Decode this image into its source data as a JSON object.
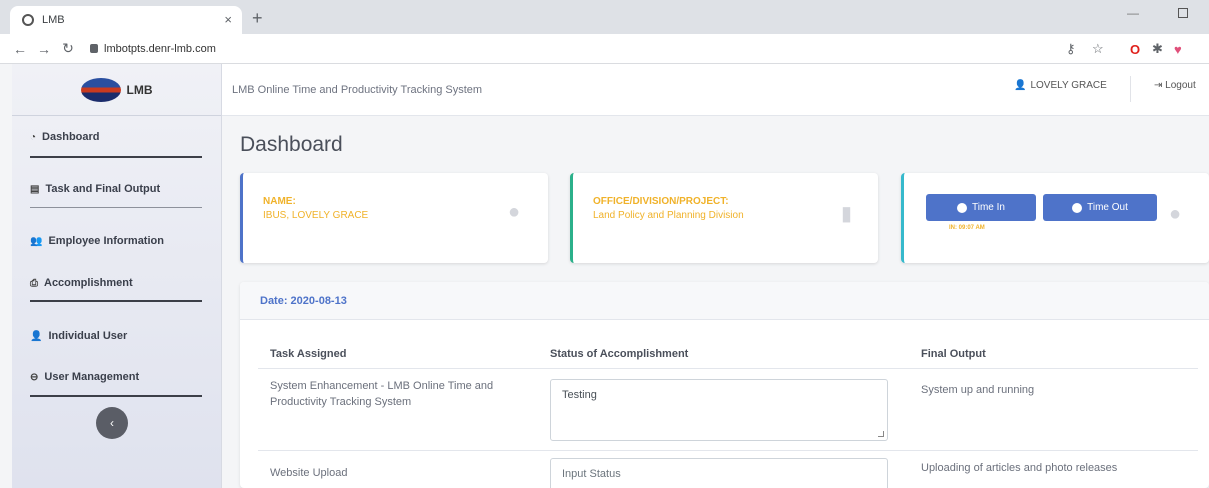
{
  "browser": {
    "tab_title": "LMB",
    "tab_close": "×",
    "new_tab": "+",
    "url": "lmbotpts.denr-lmb.com",
    "minimize": "—"
  },
  "sidebar": {
    "brand": "LMB",
    "collapse": "‹",
    "items": [
      {
        "label": "Dashboard",
        "icon": "dashboard-icon"
      },
      {
        "label": "Task and Final Output",
        "icon": "list-icon"
      },
      {
        "label": "Employee Information",
        "icon": "users-icon"
      },
      {
        "label": "Accomplishment",
        "icon": "printer-icon"
      },
      {
        "label": "Individual User",
        "icon": "user-icon"
      },
      {
        "label": "User Management",
        "icon": "user-circle-icon"
      }
    ]
  },
  "header": {
    "app_title": "LMB Online Time and Productivity Tracking System",
    "user_name": "LOVELY GRACE",
    "logout": "Logout"
  },
  "page": {
    "title": "Dashboard"
  },
  "cards": {
    "name_label": "NAME:",
    "name_value": "IBUS, LOVELY GRACE",
    "office_label": "OFFICE/DIVISION/PROJECT:",
    "office_value": "Land Policy and Planning Division",
    "time_in": "Time In",
    "time_out": "Time Out",
    "in_time": "IN: 09:07 AM"
  },
  "tasks": {
    "date": "Date: 2020-08-13",
    "columns": [
      "Task Assigned",
      "Status of Accomplishment",
      "Final Output"
    ],
    "rows": [
      {
        "task": "System Enhancement - LMB Online Time and Productivity Tracking System",
        "status": "Testing",
        "output": "System up and running"
      },
      {
        "task": "Website Upload",
        "status_placeholder": "Input Status",
        "output": "Uploading of articles and photo releases"
      }
    ]
  },
  "colors": {
    "accent": "#4e73c9",
    "highlight": "#f0b22a",
    "card_border_blue": "#4e73c9",
    "card_border_green": "#2bb08a",
    "card_border_teal": "#36b9cc"
  }
}
